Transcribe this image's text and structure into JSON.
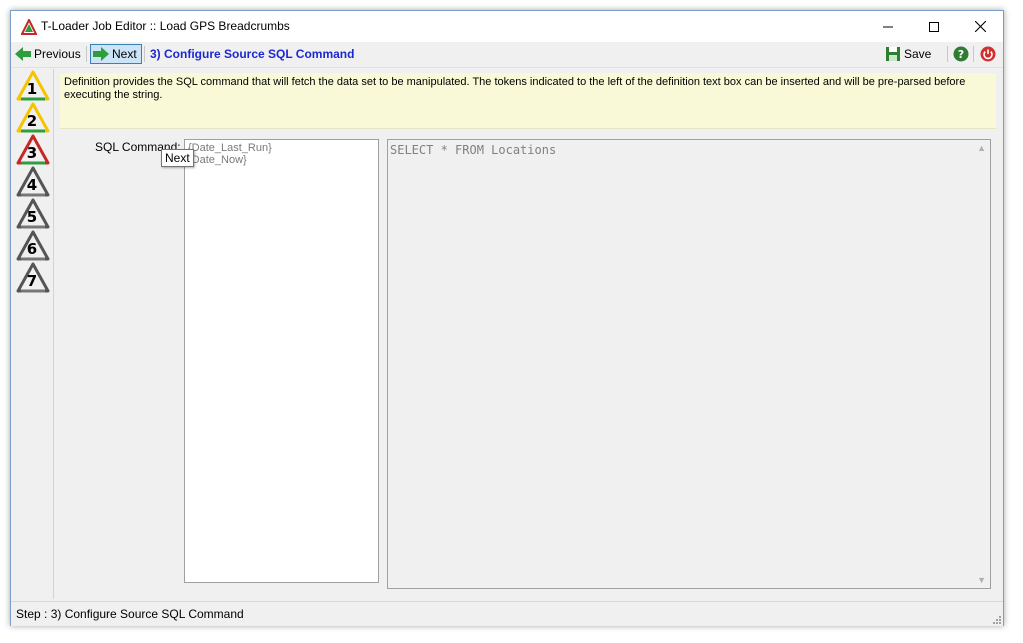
{
  "window": {
    "title": "T-Loader Job Editor :: Load GPS Breadcrumbs",
    "controls": [
      "minimize-icon",
      "maximize-icon",
      "close-icon"
    ]
  },
  "toolbar": {
    "previous_label": "Previous",
    "next_label": "Next",
    "step_title": "3) Configure Source SQL Command",
    "save_label": "Save",
    "help_icon": "help-icon",
    "exit_icon": "power-icon"
  },
  "steps": [
    {
      "number": "1",
      "state": "done"
    },
    {
      "number": "2",
      "state": "done"
    },
    {
      "number": "3",
      "state": "current"
    },
    {
      "number": "4",
      "state": "pending"
    },
    {
      "number": "5",
      "state": "pending"
    },
    {
      "number": "6",
      "state": "pending"
    },
    {
      "number": "7",
      "state": "pending"
    }
  ],
  "info": {
    "text": "Definition provides the SQL command that will fetch the data set to be manipulated. The tokens indicated to the left of the definition text box can be inserted and will be pre-parsed before executing the string."
  },
  "form": {
    "sql_label": "SQL Command:",
    "tokens": [
      "{Date_Last_Run}",
      "{Date_Now}"
    ],
    "sql_text": "SELECT * FROM Locations"
  },
  "tooltip": {
    "text": "Next"
  },
  "status": {
    "text": "Step : 3) Configure Source SQL Command"
  },
  "colors": {
    "accent": "#1c28d2",
    "info_bg": "#f9f9d7",
    "step_done": "#f5c400",
    "step_current": "#c62828",
    "step_pending": "#555555",
    "green": "#2e9e3c"
  }
}
